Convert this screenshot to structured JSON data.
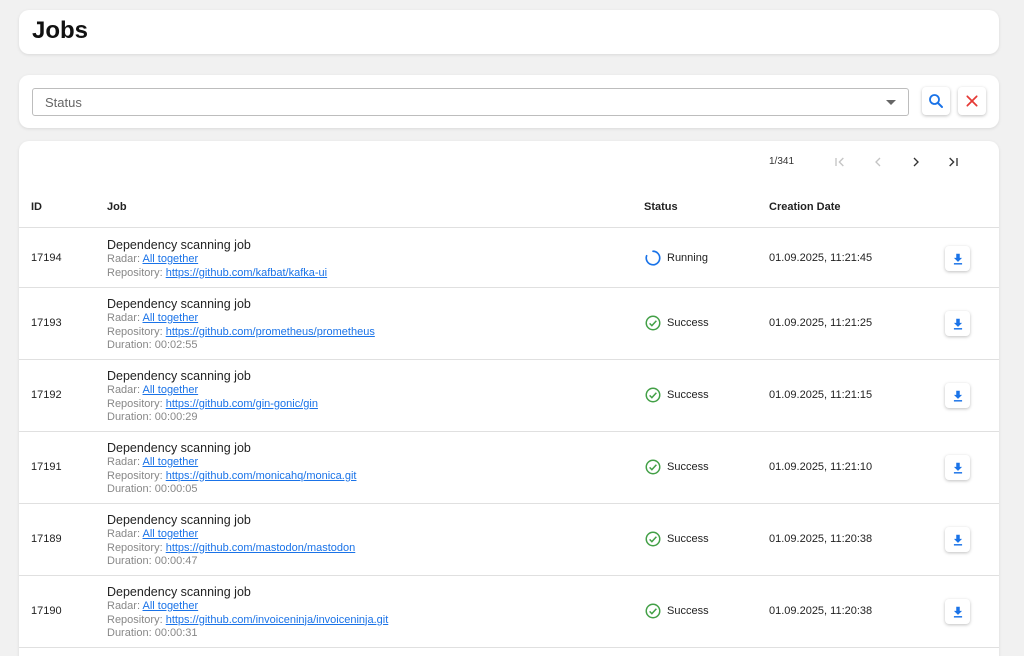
{
  "page": {
    "title": "Jobs"
  },
  "filter": {
    "status_placeholder": "Status"
  },
  "pagination": {
    "label": "1/341"
  },
  "table": {
    "columns": {
      "id": "ID",
      "job": "Job",
      "status": "Status",
      "date": "Creation Date"
    },
    "rows": [
      {
        "id": "17194",
        "title": "Dependency scanning job",
        "radar_label": "Radar:",
        "radar": "All together",
        "repo_label": "Repository:",
        "repo": "https://github.com/kafbat/kafka-ui",
        "duration_label": "",
        "duration": "",
        "status": "Running",
        "status_icon": "spinner-icon",
        "date": "01.09.2025, 11:21:45"
      },
      {
        "id": "17193",
        "title": "Dependency scanning job",
        "radar_label": "Radar:",
        "radar": "All together",
        "repo_label": "Repository:",
        "repo": "https://github.com/prometheus/prometheus",
        "duration_label": "Duration:",
        "duration": "00:02:55",
        "status": "Success",
        "status_icon": "check-circle-icon",
        "date": "01.09.2025, 11:21:25"
      },
      {
        "id": "17192",
        "title": "Dependency scanning job",
        "radar_label": "Radar:",
        "radar": "All together",
        "repo_label": "Repository:",
        "repo": "https://github.com/gin-gonic/gin",
        "duration_label": "Duration:",
        "duration": "00:00:29",
        "status": "Success",
        "status_icon": "check-circle-icon",
        "date": "01.09.2025, 11:21:15"
      },
      {
        "id": "17191",
        "title": "Dependency scanning job",
        "radar_label": "Radar:",
        "radar": "All together",
        "repo_label": "Repository:",
        "repo": "https://github.com/monicahq/monica.git",
        "duration_label": "Duration:",
        "duration": "00:00:05",
        "status": "Success",
        "status_icon": "check-circle-icon",
        "date": "01.09.2025, 11:21:10"
      },
      {
        "id": "17189",
        "title": "Dependency scanning job",
        "radar_label": "Radar:",
        "radar": "All together",
        "repo_label": "Repository:",
        "repo": "https://github.com/mastodon/mastodon",
        "duration_label": "Duration:",
        "duration": "00:00:47",
        "status": "Success",
        "status_icon": "check-circle-icon",
        "date": "01.09.2025, 11:20:38"
      },
      {
        "id": "17190",
        "title": "Dependency scanning job",
        "radar_label": "Radar:",
        "radar": "All together",
        "repo_label": "Repository:",
        "repo": "https://github.com/invoiceninja/invoiceninja.git",
        "duration_label": "Duration:",
        "duration": "00:00:31",
        "status": "Success",
        "status_icon": "check-circle-icon",
        "date": "01.09.2025, 11:20:38"
      }
    ]
  },
  "colors": {
    "accent": "#1a73e8",
    "success": "#43a047",
    "danger": "#e53935",
    "disabled": "#c4c4c4"
  }
}
